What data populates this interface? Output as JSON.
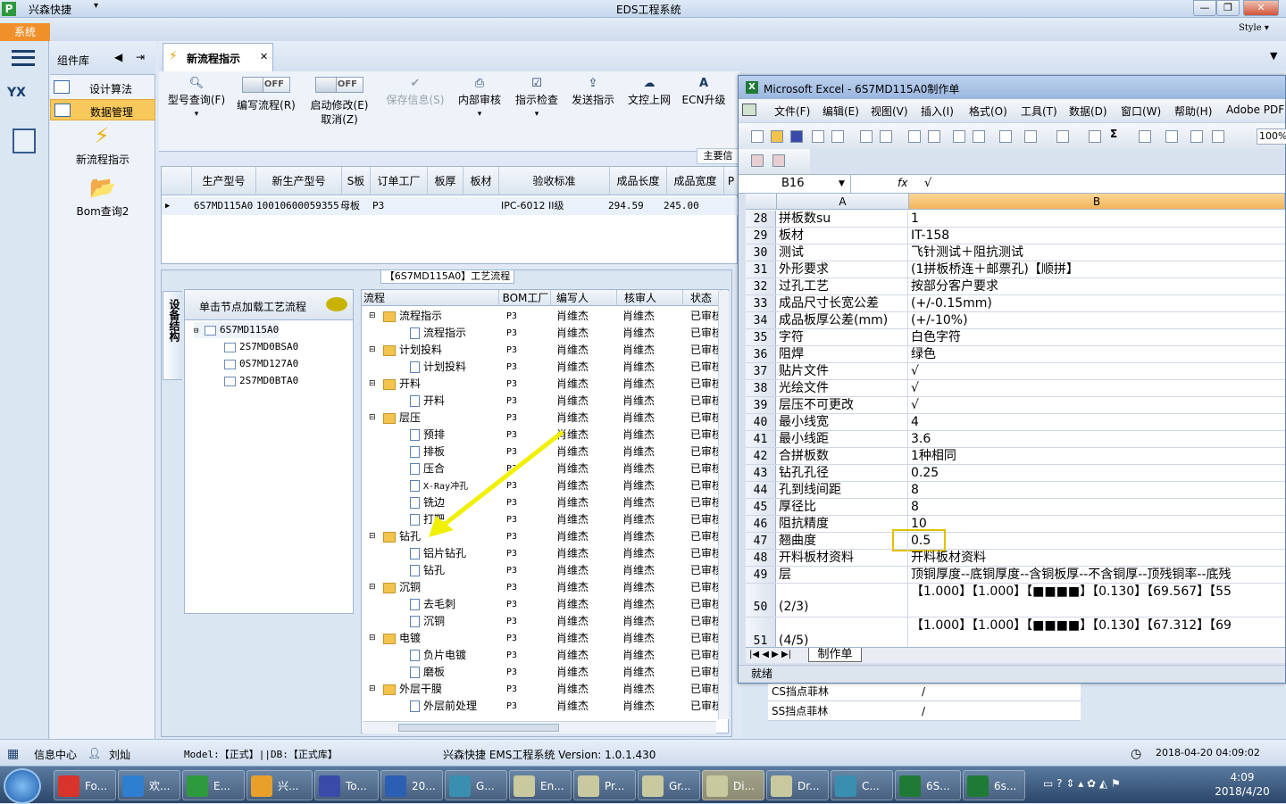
{
  "window": {
    "app_name": "兴森快捷",
    "title": "EDS工程系统",
    "menu_system": "系统",
    "style_label": "Style"
  },
  "component_lib": {
    "header": "组件库",
    "items": [
      {
        "label": "设计算法"
      },
      {
        "label": "数据管理"
      }
    ],
    "big_items": [
      {
        "label": "新流程指示"
      },
      {
        "label": "Bom查询2"
      }
    ]
  },
  "tab": {
    "label": "新流程指示"
  },
  "toolbar": {
    "buttons": [
      {
        "label": "型号查询(F)",
        "icon": "search-icon",
        "enabled": true
      },
      {
        "label": "编写流程(R)",
        "toggle": "OFF",
        "enabled": true
      },
      {
        "label": "启动修改(E)",
        "label2": "取消(Z)",
        "toggle": "OFF",
        "enabled": true
      },
      {
        "label": "保存信息(S)",
        "icon": "check-icon",
        "enabled": false
      },
      {
        "label": "内部审核",
        "icon": "printer-icon",
        "enabled": true
      },
      {
        "label": "指示检查",
        "icon": "checkbox-icon",
        "enabled": true
      },
      {
        "label": "发送指示",
        "icon": "upload-icon",
        "enabled": true
      },
      {
        "label": "文控上网",
        "icon": "cloud-upload-icon",
        "enabled": true
      },
      {
        "label": "ECN升级",
        "icon": "text-a-icon",
        "enabled": true
      }
    ],
    "main_info_label": "主要信"
  },
  "top_grid": {
    "headers": [
      "生产型号",
      "新生产型号",
      "S板",
      "订单工厂",
      "板厚",
      "板材",
      "验收标准",
      "成品长度",
      "成品宽度",
      "P"
    ],
    "row": [
      "6S7MD115A0",
      "10010600059355",
      "母板",
      "P3",
      "",
      "",
      "IPC-6012 II级",
      "294.59",
      "245.00",
      ""
    ]
  },
  "flow_section": {
    "title": "【6S7MD115A0】工艺流程",
    "side_tab": "设备结构",
    "tree_header": "单击节点加载工艺流程",
    "tree": [
      "6S7MD115A0",
      "2S7MD0BSA0",
      "0S7MD127A0",
      "2S7MD0BTA0"
    ],
    "grid_headers": [
      "流程",
      "BOM工厂",
      "编写人",
      "核审人",
      "状态"
    ],
    "rows": [
      {
        "name": "流程指示",
        "level": 0,
        "folder": true
      },
      {
        "name": "流程指示",
        "level": 1,
        "folder": false
      },
      {
        "name": "计划投料",
        "level": 0,
        "folder": true
      },
      {
        "name": "计划投料",
        "level": 1,
        "folder": false
      },
      {
        "name": "开料",
        "level": 0,
        "folder": true
      },
      {
        "name": "开料",
        "level": 1,
        "folder": false
      },
      {
        "name": "层压",
        "level": 0,
        "folder": true
      },
      {
        "name": "预排",
        "level": 1,
        "folder": false
      },
      {
        "name": "排板",
        "level": 1,
        "folder": false
      },
      {
        "name": "压合",
        "level": 1,
        "folder": false
      },
      {
        "name": "X-Ray冲孔",
        "level": 1,
        "folder": false
      },
      {
        "name": "铣边",
        "level": 1,
        "folder": false
      },
      {
        "name": "打靶",
        "level": 1,
        "folder": false
      },
      {
        "name": "钻孔",
        "level": 0,
        "folder": true
      },
      {
        "name": "铝片钻孔",
        "level": 1,
        "folder": false
      },
      {
        "name": "钻孔",
        "level": 1,
        "folder": false
      },
      {
        "name": "沉铜",
        "level": 0,
        "folder": true
      },
      {
        "name": "去毛刺",
        "level": 1,
        "folder": false
      },
      {
        "name": "沉铜",
        "level": 1,
        "folder": false
      },
      {
        "name": "电镀",
        "level": 0,
        "folder": true
      },
      {
        "name": "负片电镀",
        "level": 1,
        "folder": false
      },
      {
        "name": "磨板",
        "level": 1,
        "folder": false
      },
      {
        "name": "外层干膜",
        "level": 0,
        "folder": true
      },
      {
        "name": "外层前处理",
        "level": 1,
        "folder": false
      }
    ],
    "bom": "P3",
    "writer": "肖维杰",
    "reviewer": "肖维杰",
    "status": "已审核"
  },
  "background_rows": [
    "CS挡点菲林",
    "SS挡点菲林"
  ],
  "background_values": [
    "/",
    "/"
  ],
  "excel": {
    "title": "Microsoft Excel - 6S7MD115A0制作单",
    "menu": [
      "文件(F)",
      "编辑(E)",
      "视图(V)",
      "插入(I)",
      "格式(O)",
      "工具(T)",
      "数据(D)",
      "窗口(W)",
      "帮助(H)",
      "Adobe PDF"
    ],
    "zoom": "100%",
    "name_box": "B16",
    "formula": "√",
    "col_a": "A",
    "col_b": "B",
    "rows": [
      {
        "n": "28",
        "a": "拼板数su",
        "b": "1"
      },
      {
        "n": "29",
        "a": "板材",
        "b": "IT-158"
      },
      {
        "n": "30",
        "a": "测试",
        "b": "飞针测试＋阻抗测试"
      },
      {
        "n": "31",
        "a": "外形要求",
        "b": "(1拼板桥连＋邮票孔)【顺拼】"
      },
      {
        "n": "32",
        "a": "过孔工艺",
        "b": "按部分客户要求"
      },
      {
        "n": "33",
        "a": "成品尺寸长宽公差",
        "b": "(+/-0.15mm)"
      },
      {
        "n": "34",
        "a": "成品板厚公差(mm)",
        "b": "(+/-10%)"
      },
      {
        "n": "35",
        "a": "字符",
        "b": "白色字符"
      },
      {
        "n": "36",
        "a": "阻焊",
        "b": "绿色"
      },
      {
        "n": "37",
        "a": "贴片文件",
        "b": "√"
      },
      {
        "n": "38",
        "a": "光绘文件",
        "b": "√"
      },
      {
        "n": "39",
        "a": "层压不可更改",
        "b": "√"
      },
      {
        "n": "40",
        "a": "最小线宽",
        "b": "4"
      },
      {
        "n": "41",
        "a": "最小线距",
        "b": "3.6"
      },
      {
        "n": "42",
        "a": "合拼板数",
        "b": "1种相同"
      },
      {
        "n": "43",
        "a": "钻孔孔径",
        "b": "0.25"
      },
      {
        "n": "44",
        "a": "孔到线间距",
        "b": "8"
      },
      {
        "n": "45",
        "a": "厚径比",
        "b": "8"
      },
      {
        "n": "46",
        "a": "阻抗精度",
        "b": "10"
      },
      {
        "n": "47",
        "a": "翘曲度",
        "b": "0.5"
      },
      {
        "n": "48",
        "a": "开料板材资料",
        "b": "开料板材资料"
      },
      {
        "n": "49",
        "a": "层",
        "b": "顶铜厚度--底铜厚度--含铜板厚--不含铜厚--顶残铜率--底残"
      },
      {
        "n": "50",
        "a": "(2/3)",
        "b": "【1.000】【1.000】【■■■■】【0.130】【69.567】【55"
      },
      {
        "n": "51",
        "a": "(4/5)",
        "b": "【1.000】【1.000】【■■■■】【0.130】【67.312】【69"
      }
    ],
    "sheet_tab": "制作单",
    "status": "就绪"
  },
  "statusbar": {
    "info_center": "信息中心",
    "user": "刘灿",
    "model": "Model:【正式】||DB:【正式库】",
    "version": "兴森快捷 EMS工程系统 Version: 1.0.1.430",
    "datetime": "2018-04-20 04:09:02"
  },
  "taskbar": {
    "items": [
      {
        "label": "Fo...",
        "color": "#d9342b"
      },
      {
        "label": "欢...",
        "color": "#2f7fd0"
      },
      {
        "label": "E...",
        "color": "#2e9a3e"
      },
      {
        "label": "兴...",
        "color": "#e8a02a"
      },
      {
        "label": "To...",
        "color": "#3a4aa8"
      },
      {
        "label": "20...",
        "color": "#2b5fb3"
      },
      {
        "label": "G...",
        "color": "#3a8fb0"
      },
      {
        "label": "En...",
        "color": "#c9c9a0"
      },
      {
        "label": "Pr...",
        "color": "#c9c9a0"
      },
      {
        "label": "Gr...",
        "color": "#c9c9a0"
      },
      {
        "label": "Di...",
        "color": "#c9c9a0"
      },
      {
        "label": "Dr...",
        "color": "#c9c9a0"
      },
      {
        "label": "C...",
        "color": "#3a8fb0"
      },
      {
        "label": "6S...",
        "color": "#1f7a35"
      },
      {
        "label": "6s...",
        "color": "#1f7a35"
      }
    ],
    "time": "4:09",
    "date": "2018/4/20"
  },
  "colors": {
    "accent_orange": "#f0902a",
    "selection": "#f7c95b",
    "excel_green": "#1f7a35",
    "highlight_yellow": "#e2c200"
  }
}
